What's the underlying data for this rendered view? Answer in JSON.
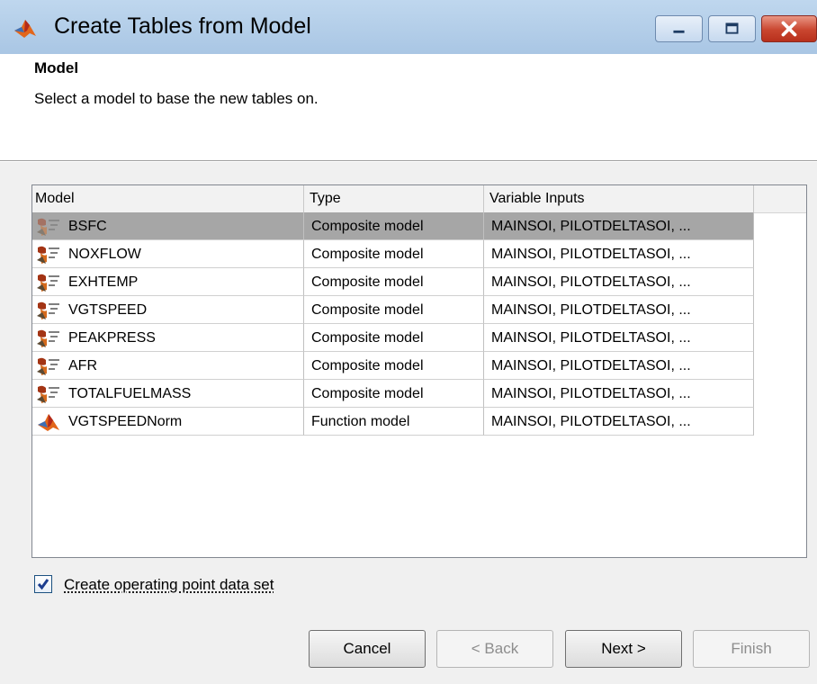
{
  "window": {
    "title": "Create Tables from Model"
  },
  "section": {
    "title": "Model",
    "description": "Select a model to base the new tables on."
  },
  "table": {
    "columns": [
      "Model",
      "Type",
      "Variable Inputs"
    ],
    "rows": [
      {
        "name": "BSFC",
        "type": "Composite model",
        "inputs": "MAINSOI, PILOTDELTASOI, ...",
        "icon": "composite-model-icon",
        "selected": true
      },
      {
        "name": "NOXFLOW",
        "type": "Composite model",
        "inputs": "MAINSOI, PILOTDELTASOI, ...",
        "icon": "composite-model-icon",
        "selected": false
      },
      {
        "name": "EXHTEMP",
        "type": "Composite model",
        "inputs": "MAINSOI, PILOTDELTASOI, ...",
        "icon": "composite-model-icon",
        "selected": false
      },
      {
        "name": "VGTSPEED",
        "type": "Composite model",
        "inputs": "MAINSOI, PILOTDELTASOI, ...",
        "icon": "composite-model-icon",
        "selected": false
      },
      {
        "name": "PEAKPRESS",
        "type": "Composite model",
        "inputs": "MAINSOI, PILOTDELTASOI, ...",
        "icon": "composite-model-icon",
        "selected": false
      },
      {
        "name": "AFR",
        "type": "Composite model",
        "inputs": "MAINSOI, PILOTDELTASOI, ...",
        "icon": "composite-model-icon",
        "selected": false
      },
      {
        "name": "TOTALFUELMASS",
        "type": "Composite model",
        "inputs": "MAINSOI, PILOTDELTASOI, ...",
        "icon": "composite-model-icon",
        "selected": false
      },
      {
        "name": "VGTSPEEDNorm",
        "type": "Function model",
        "inputs": "MAINSOI, PILOTDELTASOI, ...",
        "icon": "function-model-icon",
        "selected": false
      }
    ]
  },
  "checkbox": {
    "label": "Create operating point data set",
    "checked": true
  },
  "buttons": {
    "cancel": "Cancel",
    "back": "< Back",
    "next": "Next >",
    "finish": "Finish"
  },
  "colors": {
    "selected_row": "#a6a6a6",
    "titlebar": "#bfd7ee",
    "close_button": "#c9452f"
  }
}
